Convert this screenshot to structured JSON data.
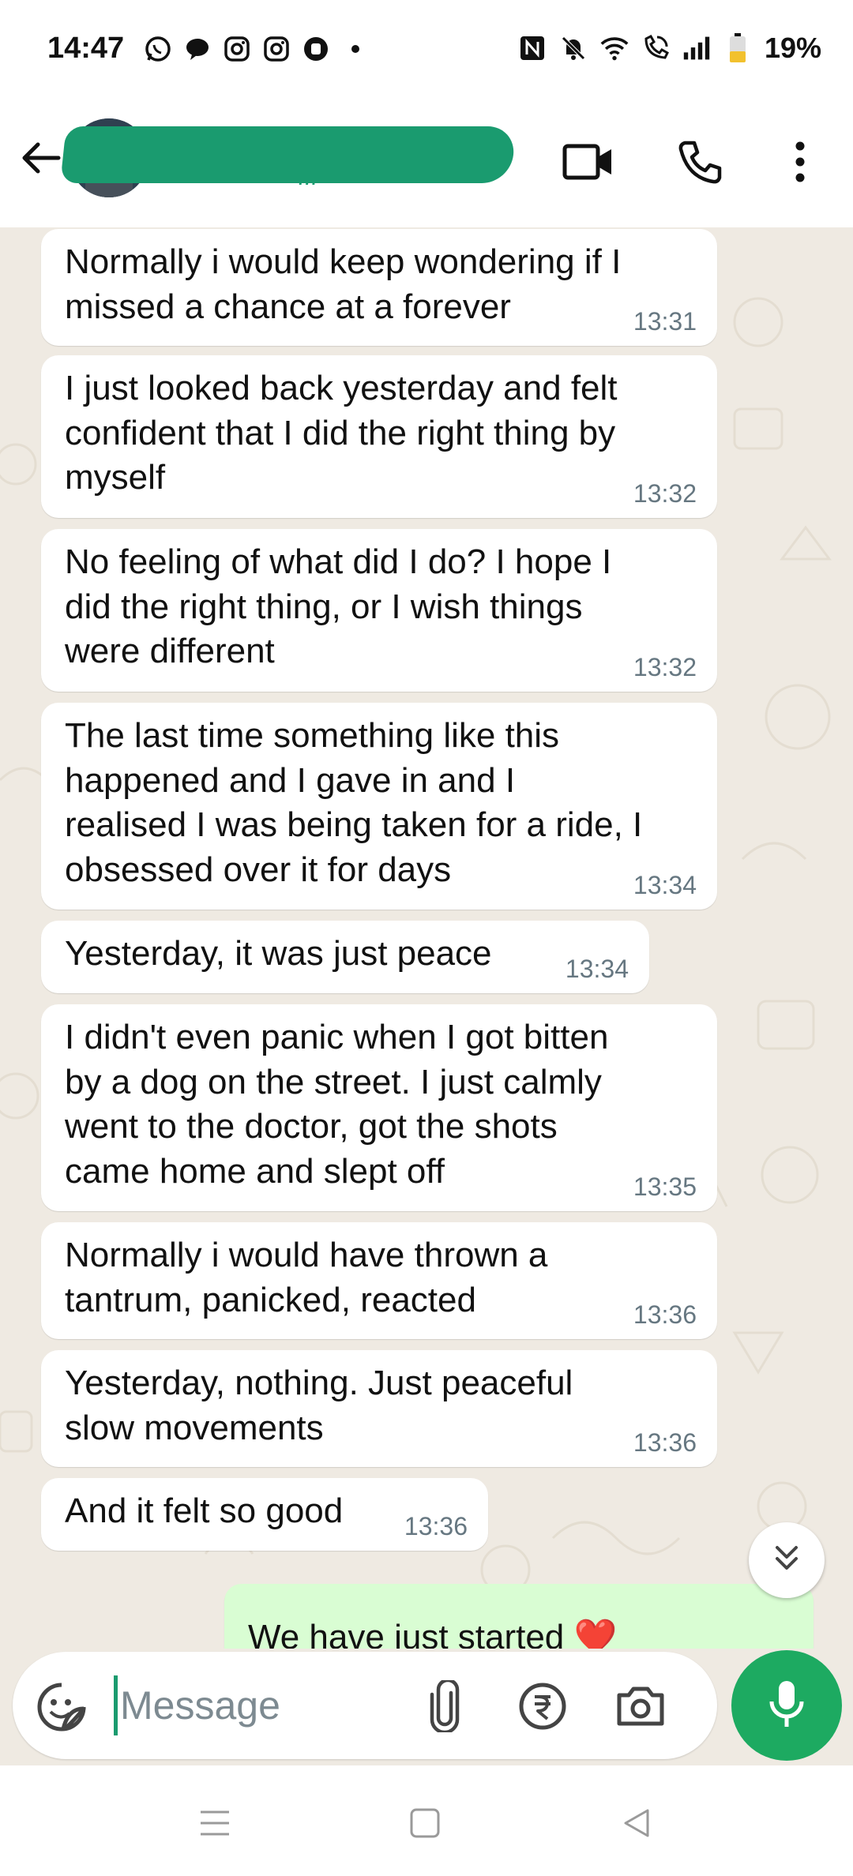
{
  "status_bar": {
    "time": "14:47",
    "battery_percent": "19%",
    "left_icons": [
      "whatsapp-icon",
      "chat-icon",
      "instagram-icon",
      "instagram-icon",
      "app-icon",
      "dot-icon"
    ],
    "right_icons": [
      "nfc-icon",
      "bell-off-icon",
      "wifi-icon",
      "wifi-call-icon",
      "signal-icon",
      "battery-icon"
    ]
  },
  "header": {
    "contact_name": "...",
    "icons": [
      "back-arrow-icon",
      "video-call-icon",
      "voice-call-icon",
      "more-vert-icon"
    ]
  },
  "messages": [
    {
      "text": "Normally i would keep wondering if I\nmissed a chance at a forever",
      "time": "13:31",
      "direction": "incoming"
    },
    {
      "text": "I just looked back yesterday and felt\nconfident that I did the right thing by\nmyself",
      "time": "13:32",
      "direction": "incoming"
    },
    {
      "text": "No feeling of what did I do? I hope I\ndid the right thing, or I wish things\nwere different",
      "time": "13:32",
      "direction": "incoming"
    },
    {
      "text": "The last time something like this\nhappened and I gave in and I\nrealised I was being taken for a ride, I\nobsessed over it for days",
      "time": "13:34",
      "direction": "incoming"
    },
    {
      "text": "Yesterday, it was just peace",
      "time": "13:34",
      "direction": "incoming"
    },
    {
      "text": "I didn't even panic when I got bitten\nby a dog on the street. I just calmly\nwent to the doctor, got the shots\ncame home and slept off",
      "time": "13:35",
      "direction": "incoming"
    },
    {
      "text": "Normally i would have thrown a\ntantrum, panicked, reacted",
      "time": "13:36",
      "direction": "incoming"
    },
    {
      "text": "Yesterday, nothing. Just peaceful\nslow movements",
      "time": "13:36",
      "direction": "incoming"
    },
    {
      "text": "And it felt so good",
      "time": "13:36",
      "direction": "incoming"
    },
    {
      "text": "We have just started ❤️",
      "time": "",
      "direction": "outgoing"
    }
  ],
  "composer": {
    "placeholder": "Message",
    "icons": [
      "sticker-icon",
      "attach-icon",
      "rupee-payment-icon",
      "camera-icon",
      "mic-icon"
    ]
  },
  "scroll_down_icon": "double-chevron-down-icon",
  "nav": {
    "icons": [
      "menu-icon",
      "home-icon",
      "back-icon"
    ]
  },
  "colors": {
    "accent": "#1daa61",
    "chat_bg": "#efeae2",
    "incoming_bubble": "#ffffff",
    "outgoing_bubble": "#d9fdd3",
    "timestamp": "#667781"
  }
}
